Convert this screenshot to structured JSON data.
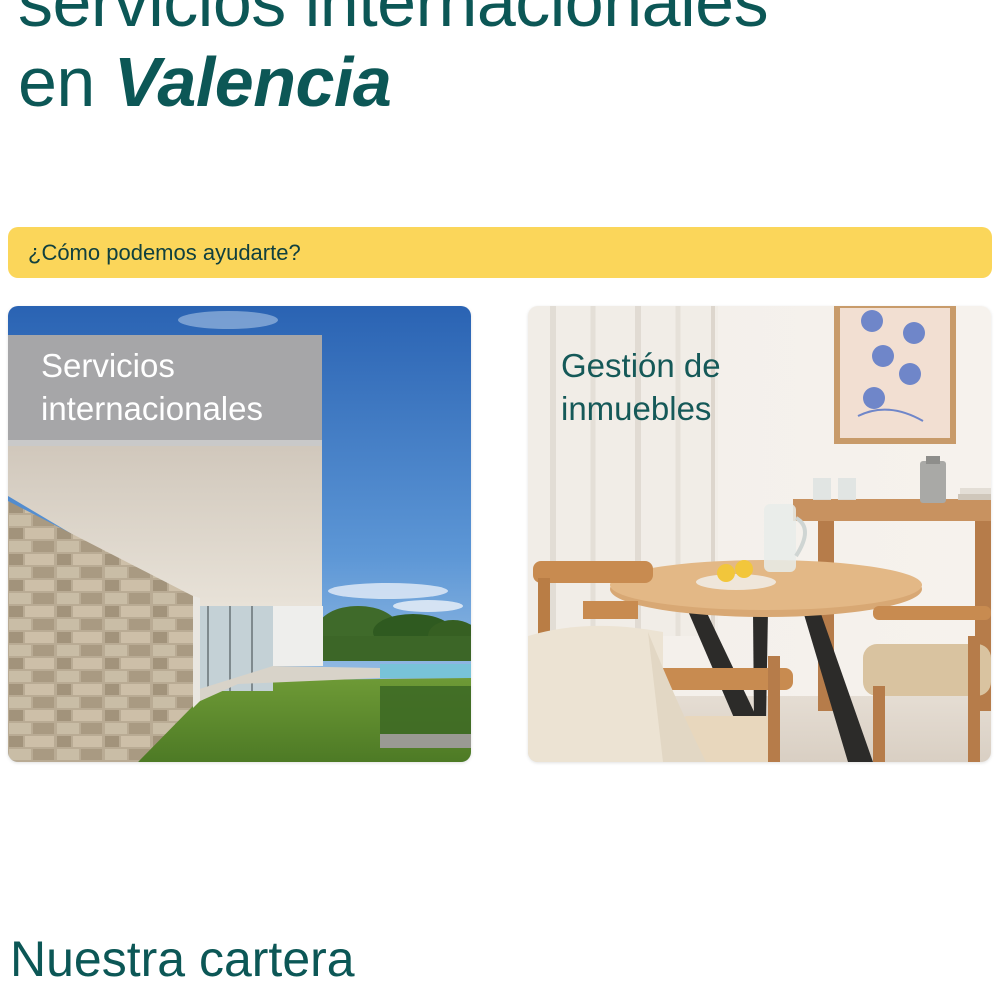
{
  "hero": {
    "title_line1": "servicios internacionales",
    "title_line2_prefix": "en ",
    "title_line2_emphasis": "Valencia"
  },
  "help_bar": {
    "label": "¿Cómo podemos ayudarte?",
    "color": "#fbd65a"
  },
  "cards": [
    {
      "title_line1": "Servicios",
      "title_line2": "internacionales",
      "image": "modern-villa-with-stone-wall-and-pool"
    },
    {
      "title_line1": "Gestión de",
      "title_line2": "inmuebles",
      "image": "dining-room-with-round-wooden-table"
    }
  ],
  "portfolio": {
    "title": "Nuestra cartera"
  },
  "colors": {
    "brand_teal": "#0c5756",
    "accent_yellow": "#fbd65a",
    "background": "#ffffff"
  }
}
